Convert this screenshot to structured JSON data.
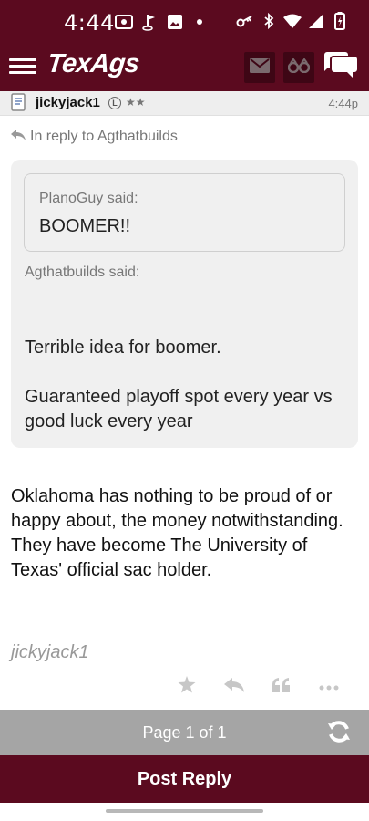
{
  "status_bar": {
    "time": "4:44",
    "left_icons": [
      "screencast-icon",
      "golf-icon",
      "image-icon",
      "dot-icon"
    ],
    "right_icons": [
      "key-icon",
      "bluetooth-icon",
      "wifi-icon",
      "signal-icon",
      "battery-icon"
    ]
  },
  "app_bar": {
    "logo": "TexAgs",
    "icons": [
      "menu-icon",
      "mail-icon",
      "binoculars-icon",
      "chat-icon"
    ]
  },
  "post": {
    "author": "jickyjack1",
    "badge": "L",
    "stars": "★★",
    "time": "4:44p",
    "in_reply_to": "In reply to Agthatbuilds",
    "nested_quote": {
      "said": "PlanoGuy said:",
      "text": "BOOMER!!"
    },
    "quote": {
      "said": "Agthatbuilds said:",
      "line1": "Terrible idea for boomer.",
      "line2": "Guaranteed playoff spot every year vs good luck every year"
    },
    "body": "Oklahoma has nothing to be proud of or happy about, the money notwithstanding. They have become The University of Texas' official sac holder.",
    "signature": "jickyjack1",
    "actions": [
      "star-icon",
      "reply-icon",
      "quote-icon",
      "more-icon"
    ]
  },
  "pager": {
    "label": "Page 1 of 1"
  },
  "post_reply": {
    "label": "Post Reply"
  },
  "colors": {
    "brand": "#5b0a1f",
    "pager": "#a5a5a5",
    "quote_bg": "#f0f0f0"
  }
}
